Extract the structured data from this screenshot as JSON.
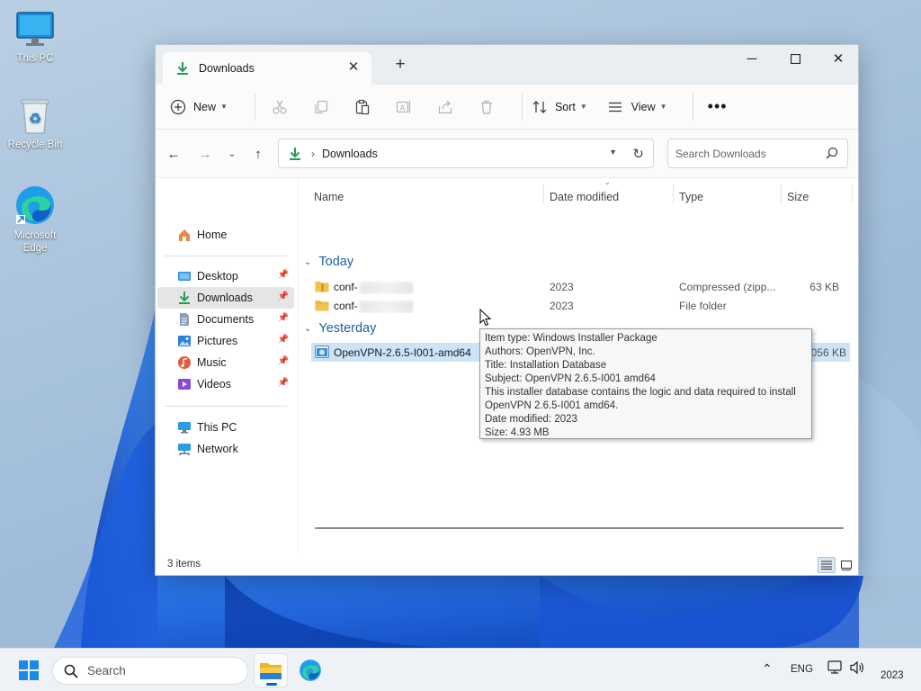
{
  "desktop": {
    "icons": [
      {
        "label": "This PC"
      },
      {
        "label": "Recycle Bin"
      },
      {
        "label": "Microsoft Edge"
      }
    ]
  },
  "window": {
    "tab_title": "Downloads",
    "toolbar": {
      "new_label": "New",
      "sort_label": "Sort",
      "view_label": "View"
    },
    "address": {
      "crumb": "Downloads"
    },
    "search": {
      "placeholder": "Search Downloads"
    },
    "sidebar": {
      "items": [
        {
          "label": "Home"
        },
        {
          "label": "Desktop"
        },
        {
          "label": "Downloads"
        },
        {
          "label": "Documents"
        },
        {
          "label": "Pictures"
        },
        {
          "label": "Music"
        },
        {
          "label": "Videos"
        },
        {
          "label": "This PC"
        },
        {
          "label": "Network"
        }
      ]
    },
    "columns": {
      "name": "Name",
      "date": "Date modified",
      "type": "Type",
      "size": "Size"
    },
    "groups": [
      {
        "label": "Today",
        "rows": [
          {
            "name": "conf-",
            "date": "2023",
            "type": "Compressed (zipp...",
            "size": "63 KB"
          },
          {
            "name": "conf-",
            "date": "2023",
            "type": "File folder",
            "size": ""
          }
        ]
      },
      {
        "label": "Yesterday",
        "rows": [
          {
            "name": "OpenVPN-2.6.5-I001-amd64",
            "date": "2023",
            "type": "Windows Installer ...",
            "size": "5,056 KB"
          }
        ]
      }
    ],
    "status": {
      "item_count": "3 items"
    },
    "tooltip": {
      "lines": [
        "Item type: Windows Installer Package",
        "Authors: OpenVPN, Inc.",
        "Title: Installation Database",
        "Subject: OpenVPN 2.6.5-I001 amd64",
        "This installer database contains the logic and data required to install",
        "OpenVPN 2.6.5-I001 amd64.",
        "Date modified: 2023",
        "Size: 4.93 MB"
      ]
    }
  },
  "taskbar": {
    "search_label": "Search",
    "language": "ENG",
    "clock": "2023"
  },
  "colors": {
    "accent": "#0067c0",
    "selection": "#cce4f7",
    "group_header": "#1f5fa6",
    "download_green": "#1f9d57",
    "folder_yellow": "#f2c14e"
  }
}
